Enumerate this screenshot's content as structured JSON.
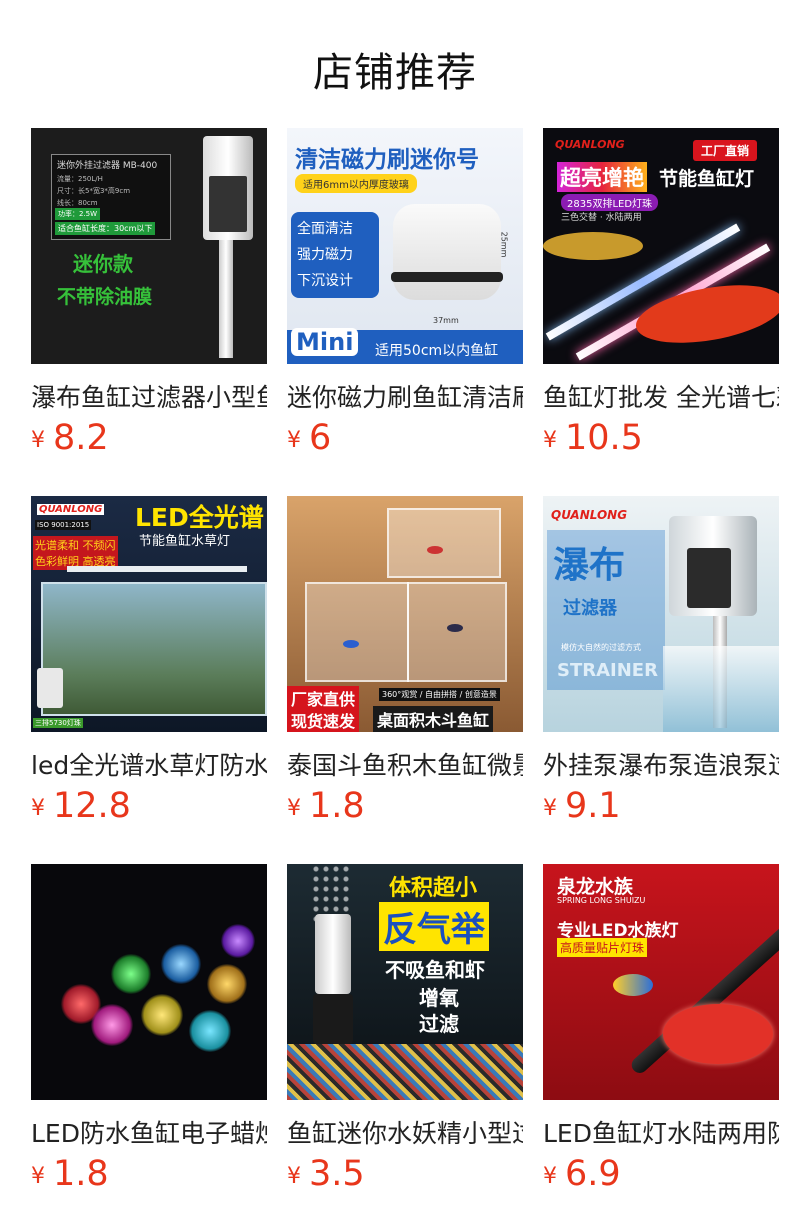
{
  "shop": {
    "title": "店铺推荐"
  },
  "currency": "¥",
  "products": [
    {
      "name": "瀑布鱼缸过滤器小型鱼缸外挂式过滤器",
      "price": "8.2",
      "image_text": [
        "迷你外挂过滤器 MB-400",
        "流量：250L/H",
        "尺寸：长5*宽3*高9cm",
        "线长：80cm",
        "功率：2.5W",
        "适合鱼缸长度：30cm以下",
        "迷你款",
        "不带除油膜"
      ]
    },
    {
      "name": "迷你磁力刷鱼缸清洁刷磁铁擦",
      "price": "6",
      "image_text": [
        "清洁磁力刷迷你号",
        "适用6mm以内厚度玻璃",
        "全面清洁",
        "强力磁力",
        "下沉设计",
        "25mm",
        "37mm",
        "Mini",
        "适用50cm以内鱼缸"
      ]
    },
    {
      "name": "鱼缸灯批发 全光谱七彩LED灯",
      "price": "10.5",
      "image_text": [
        "QUANLONG",
        "工厂直销",
        "超亮增艳",
        "节能鱼缸灯",
        "2835双排LED灯珠",
        "三色交替 · 水陆两用"
      ]
    },
    {
      "name": "led全光谱水草灯防水鱼缸灯",
      "price": "12.8",
      "image_text": [
        "QUANLONG",
        "ISO 9001:2015",
        "LED全光谱",
        "节能鱼缸水草灯",
        "光谱柔和 不频闪",
        "色彩鲜明 高透亮",
        "三排5730灯珠"
      ]
    },
    {
      "name": "泰国斗鱼积木鱼缸微景观",
      "price": "1.8",
      "image_text": [
        "厂家直供",
        "现货速发",
        "360°观赏 / 自由拼搭 / 创意造景",
        "桌面积木斗鱼缸"
      ]
    },
    {
      "name": "外挂泵瀑布泵造浪泵过滤器",
      "price": "9.1",
      "image_text": [
        "QUANLONG",
        "瀑布",
        "过滤器",
        "模仿大自然的过滤方式",
        "STRAINER"
      ]
    },
    {
      "name": "LED防水鱼缸电子蜡烛灯",
      "price": "1.8",
      "image_text": []
    },
    {
      "name": "鱼缸迷你水妖精小型过滤器",
      "price": "3.5",
      "image_text": [
        "体积超小",
        "反气举",
        "不吸鱼和虾",
        "增氧",
        "过滤"
      ]
    },
    {
      "name": "LED鱼缸灯水陆两用防水灯",
      "price": "6.9",
      "image_text": [
        "泉龙水族",
        "SPRING LONG SHUIZU",
        "专业LED水族灯",
        "高质量贴片灯珠"
      ]
    }
  ]
}
